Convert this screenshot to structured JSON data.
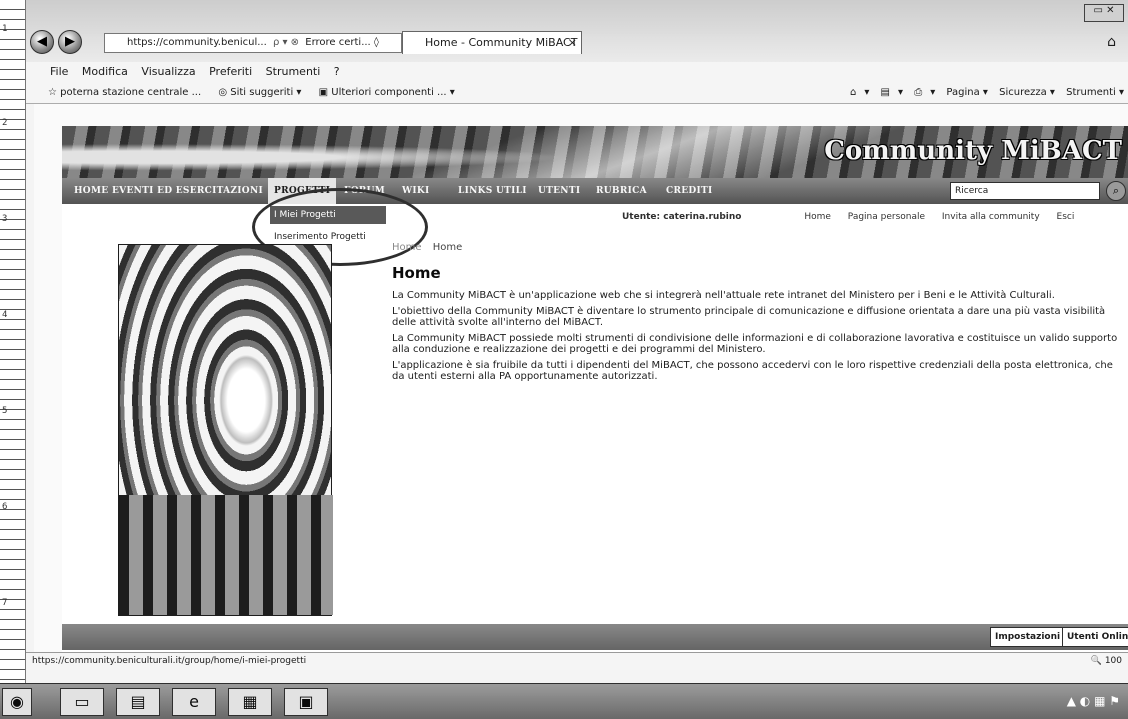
{
  "browser": {
    "url": "https://community.benicul...",
    "url_controls": "ρ ▾ ⊗",
    "error_tab": "Errore certi... ◊",
    "tab_title": "Home - Community MiBACT",
    "tab_close": "×",
    "menu": [
      "File",
      "Modifica",
      "Visualizza",
      "Preferiti",
      "Strumenti",
      "?"
    ],
    "favorites": [
      "poterna stazione centrale ...",
      "Siti suggeriti ▾",
      "Ulteriori componenti ... ▾"
    ],
    "commands": [
      "▾",
      "▾",
      "▾",
      "Pagina ▾",
      "Sicurezza ▾",
      "Strumenti ▾"
    ],
    "status_url": "https://community.beniculturali.it/group/home/i-miei-progetti",
    "zoom": "100"
  },
  "site": {
    "banner_title": "Community MiBACT",
    "nav": [
      "HOME",
      "EVENTI ED ESERCITAZIONI",
      "PROGETTI",
      "FORUM",
      "WIKI",
      "LINKS UTILI",
      "UTENTI",
      "RUBRICA",
      "CREDITI"
    ],
    "search_value": "Ricerca",
    "dropdown": [
      "I Miei Progetti",
      "Inserimento Progetti"
    ],
    "user_label": "Utente: caterina.rubino",
    "user_links": [
      "Home",
      "Pagina personale",
      "Invita alla community",
      "Esci"
    ],
    "breadcrumb_prefix": "Home",
    "breadcrumb": "Home",
    "page_title": "Home",
    "paragraphs": [
      "La Community MiBACT è un'applicazione web che si integrerà nell'attuale rete intranet del Ministero per i Beni e le Attività Culturali.",
      "L'obiettivo della Community MiBACT è diventare lo strumento principale di comunicazione e diffusione orientata a dare una più vasta visibilità delle attività svolte all'interno del MiBACT.",
      "La Community MiBACT possiede molti strumenti di condivisione delle informazioni e di collaborazione lavorativa e costituisce un valido supporto alla conduzione e realizzazione dei progetti e dei programmi del Ministero.",
      "L'applicazione è sia fruibile da tutti i dipendenti del MiBACT, che possono accedervi con le loro rispettive credenziali della posta elettronica, che da utenti esterni alla PA opportunamente autorizzati."
    ],
    "footer_buttons": [
      "Impostazioni",
      "Utenti Online"
    ]
  }
}
